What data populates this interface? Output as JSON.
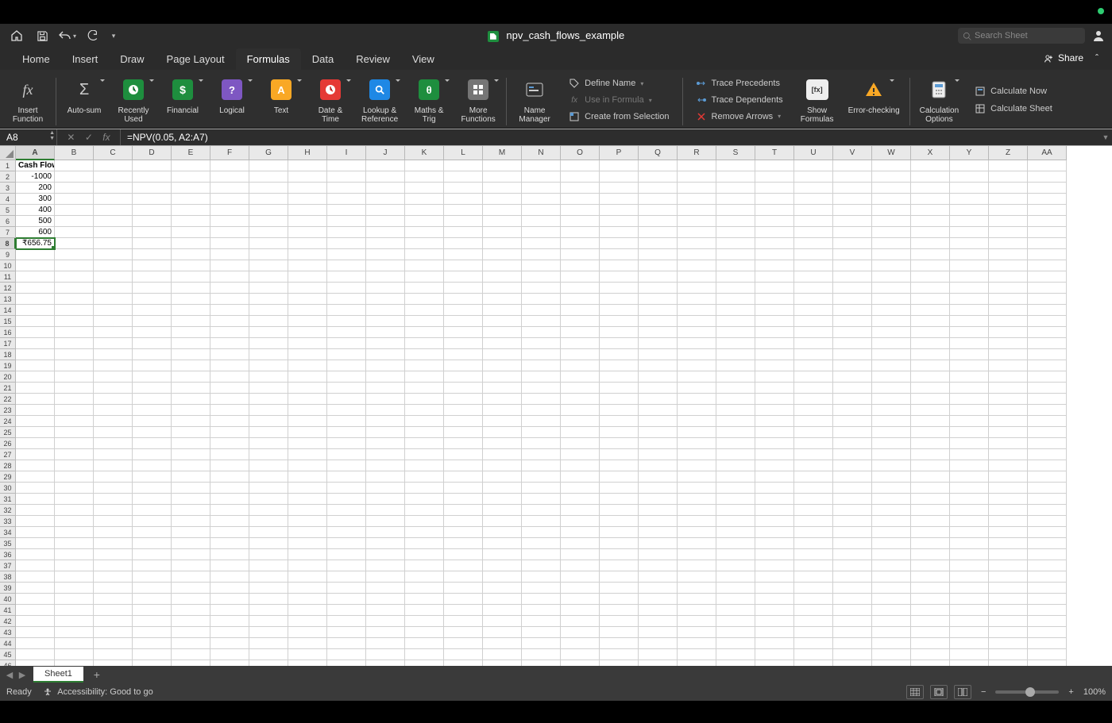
{
  "window_title": "npv_cash_flows_example",
  "search_placeholder": "Search Sheet",
  "tabs": {
    "items": [
      "Home",
      "Insert",
      "Draw",
      "Page Layout",
      "Formulas",
      "Data",
      "Review",
      "View"
    ],
    "active_index": 4,
    "share": "Share"
  },
  "ribbon": {
    "insert_function": "Insert\nFunction",
    "autosum": "Auto-sum",
    "recently": "Recently\nUsed",
    "financial": "Financial",
    "logical": "Logical",
    "text": "Text",
    "date_time": "Date &\nTime",
    "lookup": "Lookup &\nReference",
    "math": "Maths &\nTrig",
    "more": "More\nFunctions",
    "name_mgr": "Name\nManager",
    "define_name": "Define Name",
    "use_in_formula": "Use in Formula",
    "create_from_selection": "Create from Selection",
    "trace_precedents": "Trace Precedents",
    "trace_dependents": "Trace Dependents",
    "remove_arrows": "Remove Arrows",
    "show_formulas": "Show\nFormulas",
    "error_checking": "Error-checking",
    "calc_options": "Calculation\nOptions",
    "calc_now": "Calculate Now",
    "calc_sheet": "Calculate Sheet"
  },
  "formula_bar": {
    "cell_ref": "A8",
    "formula": "=NPV(0.05, A2:A7)"
  },
  "columns": [
    "A",
    "B",
    "C",
    "D",
    "E",
    "F",
    "G",
    "H",
    "I",
    "J",
    "K",
    "L",
    "M",
    "N",
    "O",
    "P",
    "Q",
    "R",
    "S",
    "T",
    "U",
    "V",
    "W",
    "X",
    "Y",
    "Z",
    "AA"
  ],
  "row_count": 46,
  "selected": {
    "row": 8,
    "col": "A"
  },
  "cell_data": {
    "A1": "Cash Flow",
    "A2": "-1000",
    "A3": "200",
    "A4": "300",
    "A5": "400",
    "A6": "500",
    "A7": "600",
    "A8": "₹656.75"
  },
  "sheet_tabs": {
    "active": "Sheet1"
  },
  "status": {
    "ready": "Ready",
    "accessibility": "Accessibility: Good to go",
    "zoom": "100%"
  }
}
